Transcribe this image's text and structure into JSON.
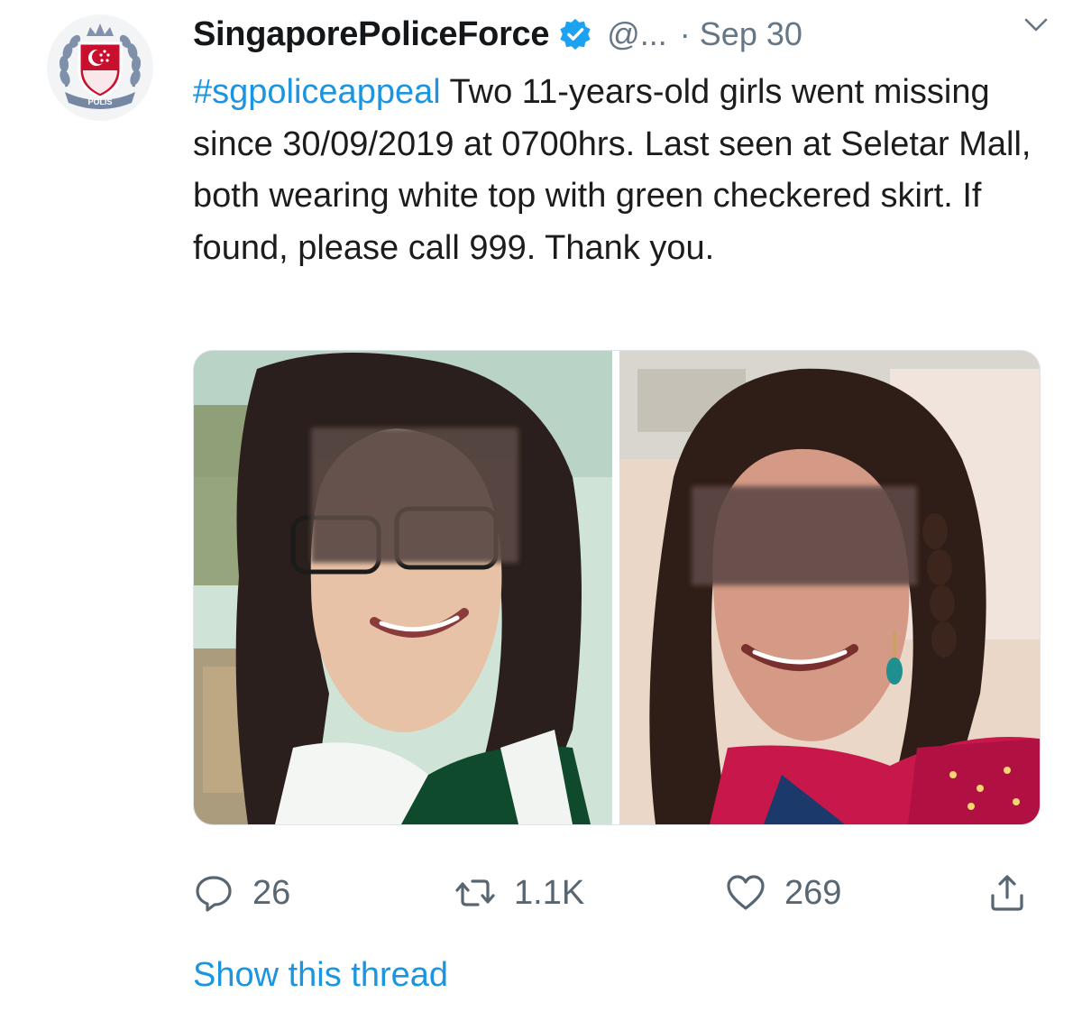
{
  "tweet": {
    "display_name": "SingaporePoliceForce",
    "handle": "@...",
    "separator": "·",
    "date": "Sep 30",
    "hashtag": "#sgpoliceappeal",
    "body": " Two 11-years-old girls went missing since 30/09/2019 at 0700hrs. Last seen at Seletar Mall, both wearing white top with green checkered skirt. If found, please call 999. Thank you.",
    "avatar_icon": "police-crest-icon",
    "verified_icon": "verified-badge-icon",
    "caret_icon": "chevron-down-icon",
    "avatar_text": "POLIS"
  },
  "actions": {
    "reply": {
      "icon": "reply-icon",
      "count": "26"
    },
    "retweet": {
      "icon": "retweet-icon",
      "count": "1.1K"
    },
    "like": {
      "icon": "heart-icon",
      "count": "269"
    },
    "share": {
      "icon": "share-icon"
    }
  },
  "show_thread_label": "Show this thread",
  "colors": {
    "accent": "#1b95e0",
    "muted": "#657786",
    "text": "#1c1c1c"
  }
}
